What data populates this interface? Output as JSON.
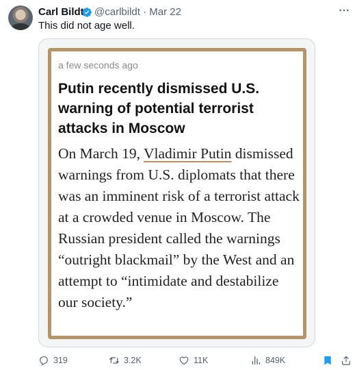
{
  "author": {
    "name": "Carl Bildt",
    "handle_line": "@carlbildt · Mar 22"
  },
  "tweet": {
    "text": "This did not age well."
  },
  "embedded_article": {
    "timestamp": "a few seconds ago",
    "headline": "Putin recently dismissed U.S. warning of potential terrorist attacks in Moscow",
    "body_prefix": "On March 19, ",
    "body_link": "Vladimir Putin",
    "body_rest": " dismissed warnings from U.S. diplomats that there was an imminent risk of a terrorist attack at a crowded venue in Moscow. The Russian president called the warnings “outright blackmail” by the West and an attempt to “intimidate and destabilize our society.”"
  },
  "actions": {
    "replies": "319",
    "reposts": "3.2K",
    "likes": "11K",
    "views": "849K"
  },
  "icons": {
    "verified": "verified-badge-icon",
    "more": "more-icon",
    "reply": "reply-icon",
    "repost": "repost-icon",
    "like": "heart-icon",
    "views": "views-icon",
    "bookmark": "bookmark-icon",
    "share": "share-icon"
  },
  "colors": {
    "verified": "#1d9bf0",
    "bookmark": "#1d9bf0",
    "card_border": "#b7936a",
    "secondary_text": "#536471"
  }
}
